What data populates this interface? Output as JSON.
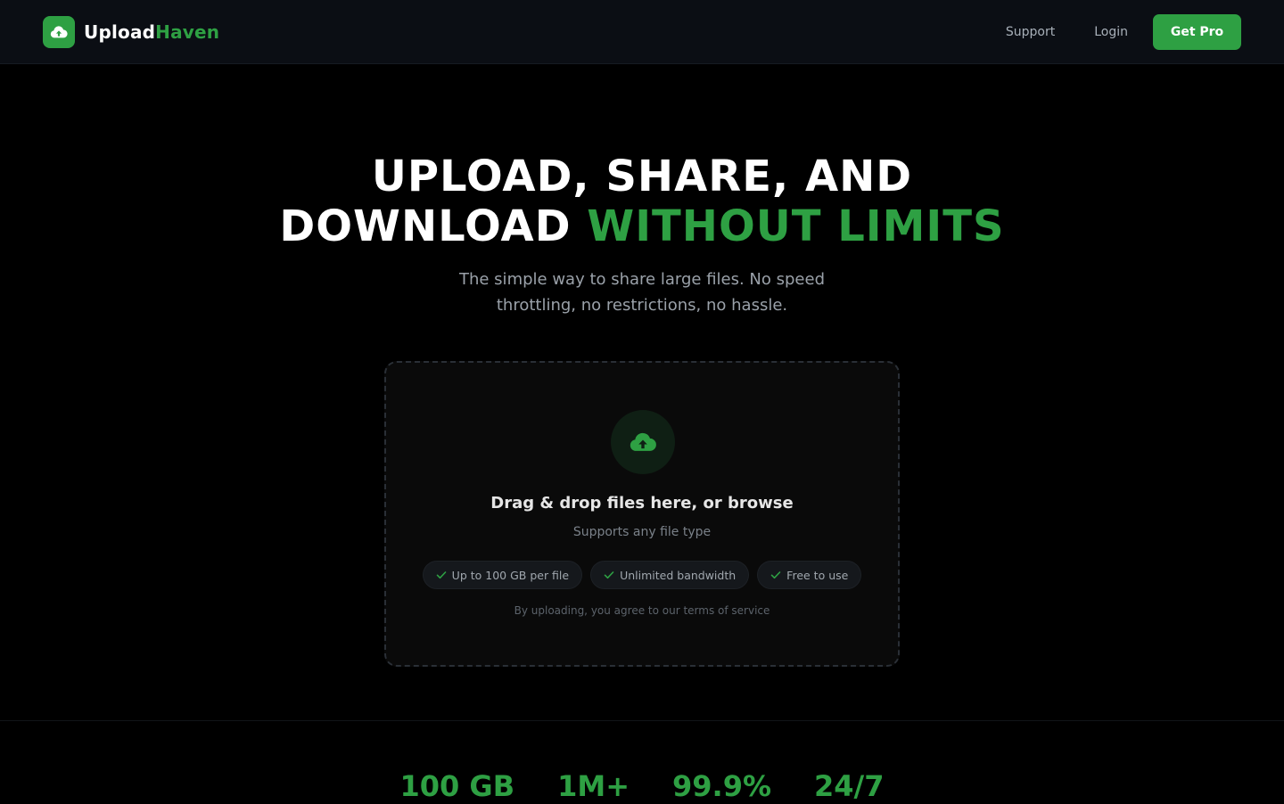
{
  "header": {
    "brand_part1": "Upload",
    "brand_part2": "Haven",
    "nav": {
      "support": "Support",
      "login": "Login"
    },
    "cta": "Get Pro"
  },
  "hero": {
    "line1": "UPLOAD, SHARE, AND",
    "line2_plain": "DOWNLOAD ",
    "line2_accent": "WITHOUT LIMITS",
    "subtitle_line1": "The simple way to share large files. No speed",
    "subtitle_line2": "throttling, no restrictions, no hassle."
  },
  "dropzone": {
    "title": "Drag & drop files here, or browse",
    "subtitle": "Supports any file type",
    "features": [
      "Up to 100 GB per file",
      "Unlimited bandwidth",
      "Free to use"
    ],
    "terms": "By uploading, you agree to our terms of service"
  },
  "stats": [
    "100 GB",
    "1M+",
    "99.9%",
    "24/7"
  ],
  "colors": {
    "accent": "#2ea043",
    "background": "#000000",
    "header_bg": "#0b0e14"
  },
  "icons": {
    "logo": "cloud-upload-icon",
    "dropzone": "cloud-upload-icon",
    "feature": "check-icon"
  }
}
